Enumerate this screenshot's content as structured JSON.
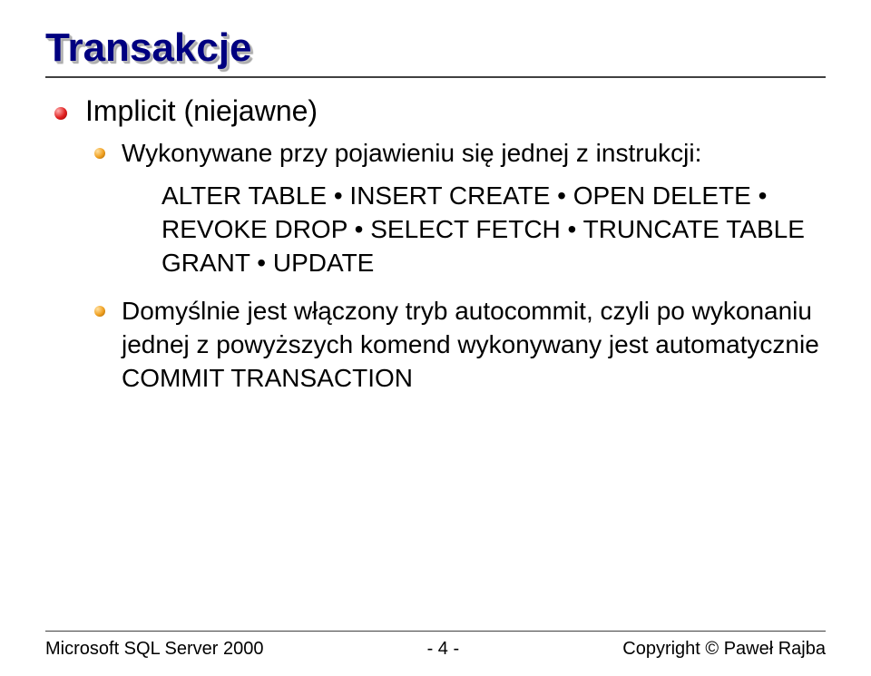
{
  "title": "Transakcje",
  "bullets": {
    "lvl1": "Implicit (niejawne)",
    "lvl2a": "Wykonywane przy pojawieniu się jednej z instrukcji:",
    "lvl3": "ALTER TABLE • INSERT CREATE • OPEN DELETE • REVOKE DROP • SELECT FETCH • TRUNCATE TABLE GRANT • UPDATE",
    "lvl2b": "Domyślnie jest włączony tryb autocommit, czyli po wykonaniu jednej z powyższych komend wykonywany jest automatycznie COMMIT TRANSACTION"
  },
  "footer": {
    "left": "Microsoft SQL Server 2000",
    "center": "- 4 -",
    "right": "Copyright © Paweł Rajba"
  }
}
